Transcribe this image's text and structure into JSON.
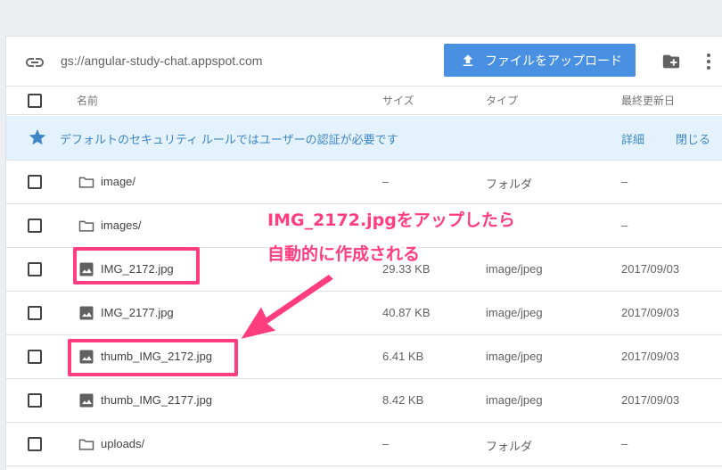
{
  "toolbar": {
    "bucket_path": "gs://angular-study-chat.appspot.com",
    "upload_label": "ファイルをアップロード"
  },
  "table_header": {
    "name": "名前",
    "size": "サイズ",
    "type": "タイプ",
    "updated": "最終更新日"
  },
  "notice": {
    "message": "デフォルトのセキュリティ ルールではユーザーの認証が必要です",
    "details_label": "詳細",
    "close_label": "閉じる"
  },
  "files": [
    {
      "name": "image/",
      "size": "–",
      "type": "フォルダ",
      "updated": "–",
      "icon": "folder-icon"
    },
    {
      "name": "images/",
      "size": "",
      "type": "",
      "updated": "–",
      "icon": "folder-icon"
    },
    {
      "name": "IMG_2172.jpg",
      "size": "29.33 KB",
      "type": "image/jpeg",
      "updated": "2017/09/03",
      "icon": "image-icon"
    },
    {
      "name": "IMG_2177.jpg",
      "size": "40.87 KB",
      "type": "image/jpeg",
      "updated": "2017/09/03",
      "icon": "image-icon"
    },
    {
      "name": "thumb_IMG_2172.jpg",
      "size": "6.41 KB",
      "type": "image/jpeg",
      "updated": "2017/09/03",
      "icon": "image-icon"
    },
    {
      "name": "thumb_IMG_2177.jpg",
      "size": "8.42 KB",
      "type": "image/jpeg",
      "updated": "2017/09/03",
      "icon": "image-icon"
    },
    {
      "name": "uploads/",
      "size": "–",
      "type": "フォルダ",
      "updated": "–",
      "icon": "folder-icon"
    }
  ],
  "annotation": {
    "line1": "IMG_2172.jpgをアップしたら",
    "line2": "自動的に作成される",
    "color": "#ff3d7f"
  },
  "colors": {
    "accent": "#4a90e2",
    "notice_bg": "#e3f2fd",
    "notice_text": "#3f86c6"
  }
}
